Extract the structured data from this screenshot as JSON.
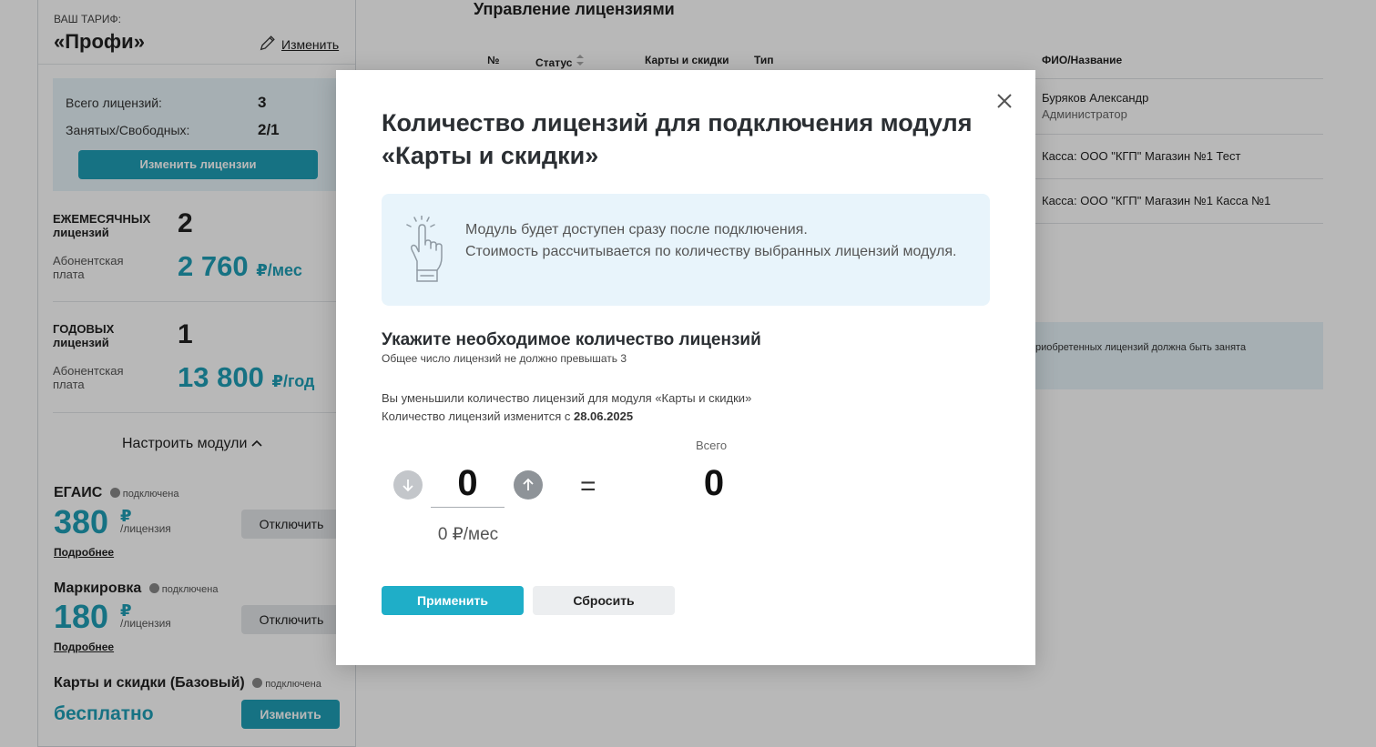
{
  "sidebar": {
    "tariff_caption": "ВАШ ТАРИФ:",
    "tariff_name": "«Профи»",
    "change_link": "Изменить",
    "total_licenses_label": "Всего лицензий:",
    "total_licenses_value": "3",
    "busy_free_label": "Занятых/Свободных:",
    "busy_free_value": "2/1",
    "change_licenses_button": "Изменить лицензии",
    "monthly": {
      "title": "ЕЖЕМЕСЯЧНЫХ лицензий",
      "count": "2",
      "fee_label": "Абонентская плата",
      "price": "2 760",
      "unit": "₽/мес"
    },
    "yearly": {
      "title": "ГОДОВЫХ лицензий",
      "count": "1",
      "fee_label": "Абонентская плата",
      "price": "13 800",
      "unit": "₽/год"
    },
    "setup_modules": "Настроить модули",
    "modules": [
      {
        "name": "ЕГАИС",
        "status": "подключена",
        "price": "380",
        "currency": "₽",
        "per": "/лицензия",
        "more": "Подробнее",
        "action": "Отключить"
      },
      {
        "name": "Маркировка",
        "status": "подключена",
        "price": "180",
        "currency": "₽",
        "per": "/лицензия",
        "more": "Подробнее",
        "action": "Отключить"
      },
      {
        "name": "Карты и скидки (Базовый)",
        "status": "подключена",
        "price": "бесплатно",
        "action": "Изменить"
      }
    ]
  },
  "main": {
    "title": "Управление лицензиями",
    "columns": [
      "№",
      "Статус",
      "Карты и скидки",
      "Тип",
      "ФИО/Название"
    ],
    "rows": [
      {
        "name": "Буряков Александр",
        "role": "Администратор"
      },
      {
        "name": "Касса: ООО \"КГП\" Магазин №1 Тест"
      },
      {
        "name": "Касса: ООО \"КГП\" Магазин №1 Касса №1"
      }
    ],
    "banner_text": "риобретенных лицензий должна быть занята"
  },
  "modal": {
    "title": "Количество лицензий для подключения модуля «Карты и скидки»",
    "notice_line1": "Модуль будет доступен сразу после подключения.",
    "notice_line2": "Стоимость рассчитывается по количеству выбранных лицензий модуля.",
    "section_title": "Укажите необходимое количество лицензий",
    "section_sub": "Общее число лицензий не должно превышать 3",
    "warn_line1": "Вы уменьшили количество лицензий для модуля «Карты и скидки»",
    "warn_line2_prefix": "Количество лицензий изменится с ",
    "warn_date": "28.06.2025",
    "quantity": "0",
    "quantity_price": "0 ₽/мес",
    "equals": "=",
    "total_label": "Всего",
    "total_value": "0",
    "apply_button": "Применить",
    "reset_button": "Сбросить"
  },
  "colors": {
    "accent": "#1f9fb6",
    "info_bg": "#e8f4fb",
    "overlay": "rgba(0,0,0,0.28)"
  }
}
